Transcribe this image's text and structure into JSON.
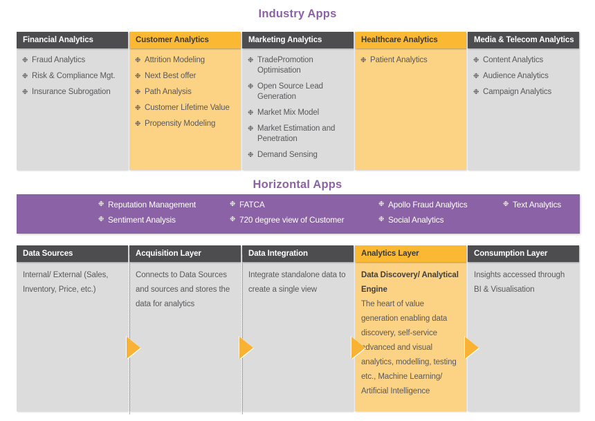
{
  "theme": {
    "purple": "#8A62A5",
    "title_purple": "#8E62A8",
    "header_dark": "#4D4D4F",
    "header_orange": "#FBB832",
    "body_gray": "#DCDCDD",
    "body_orange": "#FCD384",
    "arrow_orange": "#F9B233"
  },
  "bullet_glyph": "❉",
  "industry": {
    "title": "Industry Apps",
    "columns": [
      {
        "header": "Financial Analytics",
        "accent": "dark",
        "items": [
          "Fraud Analytics",
          "Risk & Compliance Mgt.",
          "Insurance Subrogation"
        ]
      },
      {
        "header": "Customer Analytics",
        "accent": "orange",
        "items": [
          "Attrition Modeling",
          "Next Best offer",
          "Path Analysis",
          "Customer Lifetime Value",
          "Propensity Modeling"
        ]
      },
      {
        "header": "Marketing Analytics",
        "accent": "dark",
        "items": [
          "TradePromotion Optimisation",
          "Open Source Lead Generation",
          "Market Mix Model",
          "Market Estimation and Penetration",
          "Demand Sensing"
        ]
      },
      {
        "header": "Healthcare Analytics",
        "accent": "orange",
        "items": [
          "Patient Analytics"
        ]
      },
      {
        "header": "Media & Telecom Analytics",
        "accent": "dark",
        "items": [
          "Content Analytics",
          "Audience Analytics",
          "Campaign Analytics"
        ]
      }
    ]
  },
  "horizontal": {
    "title": "Horizontal Apps",
    "columns": [
      {
        "items": [
          "Reputation Management",
          "Sentiment Analysis"
        ]
      },
      {
        "items": [
          "FATCA",
          "720 degree view of Customer"
        ]
      },
      {
        "items": [
          "Apollo Fraud Analytics",
          "Social Analytics"
        ]
      },
      {
        "items": [
          "Text Analytics"
        ]
      }
    ]
  },
  "layers": {
    "columns": [
      {
        "header": "Data Sources",
        "accent": "dark",
        "lines": [
          {
            "text": "Internal/ External (Sales, Inventory, Price, etc.)",
            "bold": false
          }
        ]
      },
      {
        "header": "Acquisition Layer",
        "accent": "dark",
        "lines": [
          {
            "text": "Connects to Data Sources and sources and stores the data for analytics",
            "bold": false
          }
        ]
      },
      {
        "header": "Data Integration",
        "accent": "dark",
        "lines": [
          {
            "text": "Integrate standalone data to create a single view",
            "bold": false
          }
        ]
      },
      {
        "header": "Analytics Layer",
        "accent": "orange",
        "lines": [
          {
            "text": "Data Discovery/ Analytical Engine",
            "bold": true
          },
          {
            "text": "The heart of value generation enabling data discovery, self-service advanced and visual analytics, modelling, testing etc., Machine Learning/ Artificial Intelligence",
            "bold": false
          }
        ]
      },
      {
        "header": "Consumption Layer",
        "accent": "dark",
        "lines": [
          {
            "text": "Insights accessed through BI & Visualisation",
            "bold": false
          }
        ]
      }
    ]
  }
}
